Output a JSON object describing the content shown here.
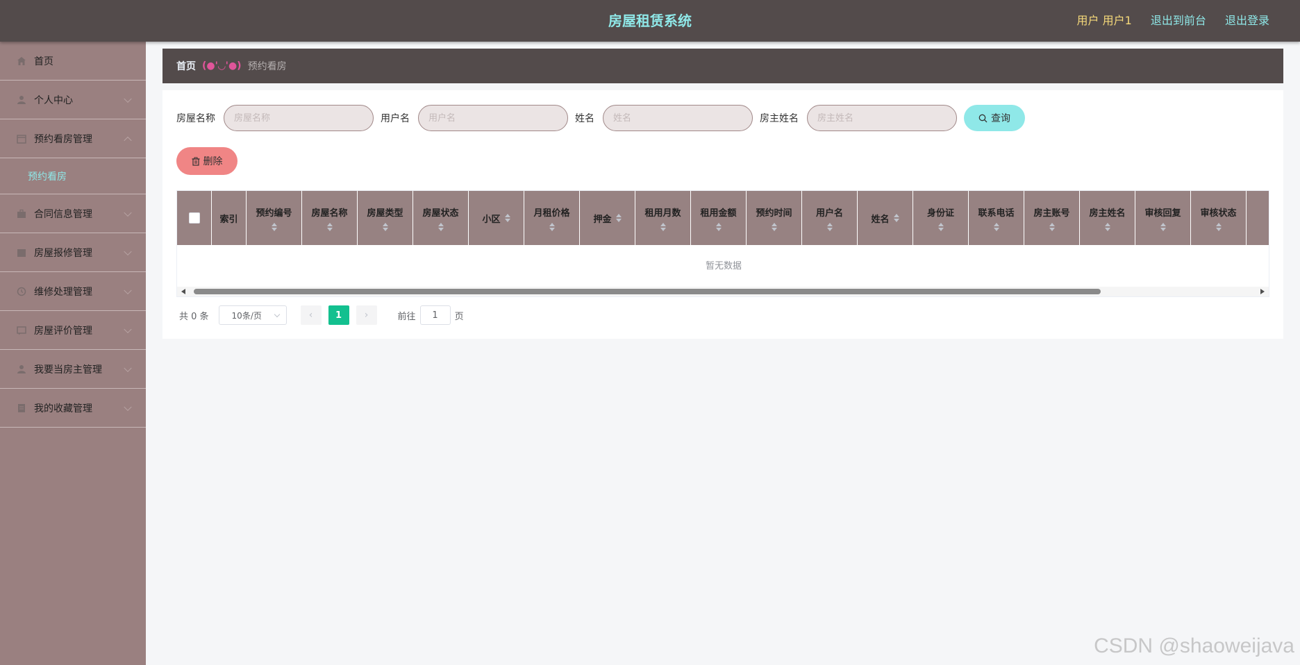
{
  "header": {
    "title": "房屋租赁系统",
    "user_label": "用户 用户1",
    "front_link": "退出到前台",
    "logout_link": "退出登录"
  },
  "sidebar": {
    "items": [
      {
        "label": "首页",
        "icon": "home-icon"
      },
      {
        "label": "个人中心",
        "icon": "user-icon"
      },
      {
        "label": "预约看房管理",
        "icon": "calendar-icon",
        "expanded": true,
        "children": [
          {
            "label": "预约看房",
            "active": true
          }
        ]
      },
      {
        "label": "合同信息管理",
        "icon": "briefcase-icon"
      },
      {
        "label": "房屋报修管理",
        "icon": "calendar-icon"
      },
      {
        "label": "维修处理管理",
        "icon": "clock-icon"
      },
      {
        "label": "房屋评价管理",
        "icon": "message-icon"
      },
      {
        "label": "我要当房主管理",
        "icon": "user-icon"
      },
      {
        "label": "我的收藏管理",
        "icon": "document-icon"
      }
    ]
  },
  "breadcrumb": {
    "home": "首页",
    "separator": "(●'◡'●)",
    "current": "预约看房"
  },
  "search": {
    "house_name_label": "房屋名称",
    "house_name_placeholder": "房屋名称",
    "username_label": "用户名",
    "username_placeholder": "用户名",
    "name_label": "姓名",
    "name_placeholder": "姓名",
    "owner_name_label": "房主姓名",
    "owner_name_placeholder": "房主姓名",
    "query_button": "查询"
  },
  "actions": {
    "delete_button": "删除"
  },
  "table": {
    "columns": [
      {
        "label": "索引",
        "sortable": false
      },
      {
        "label": "预约编号",
        "sortable": true
      },
      {
        "label": "房屋名称",
        "sortable": true
      },
      {
        "label": "房屋类型",
        "sortable": true
      },
      {
        "label": "房屋状态",
        "sortable": true
      },
      {
        "label": "小区",
        "sortable": true
      },
      {
        "label": "月租价格",
        "sortable": true
      },
      {
        "label": "押金",
        "sortable": true
      },
      {
        "label": "租用月数",
        "sortable": true
      },
      {
        "label": "租用金额",
        "sortable": true
      },
      {
        "label": "预约时间",
        "sortable": true
      },
      {
        "label": "用户名",
        "sortable": true
      },
      {
        "label": "姓名",
        "sortable": true
      },
      {
        "label": "身份证",
        "sortable": true
      },
      {
        "label": "联系电话",
        "sortable": true
      },
      {
        "label": "房主账号",
        "sortable": true
      },
      {
        "label": "房主姓名",
        "sortable": true
      },
      {
        "label": "审核回复",
        "sortable": true
      },
      {
        "label": "审核状态",
        "sortable": true
      }
    ],
    "empty_text": "暂无数据"
  },
  "pagination": {
    "total_text": "共 0 条",
    "page_size": "10条/页",
    "current_page": "1",
    "goto_label": "前往",
    "goto_value": "1",
    "page_suffix": "页"
  },
  "colors": {
    "header_bg": "#534b4b",
    "sidebar_bg": "#9a8080",
    "accent_cyan": "#8fe8e8",
    "delete_pink": "#f08585",
    "page_active": "#13c08f"
  },
  "watermark": "CSDN @shaoweijava"
}
